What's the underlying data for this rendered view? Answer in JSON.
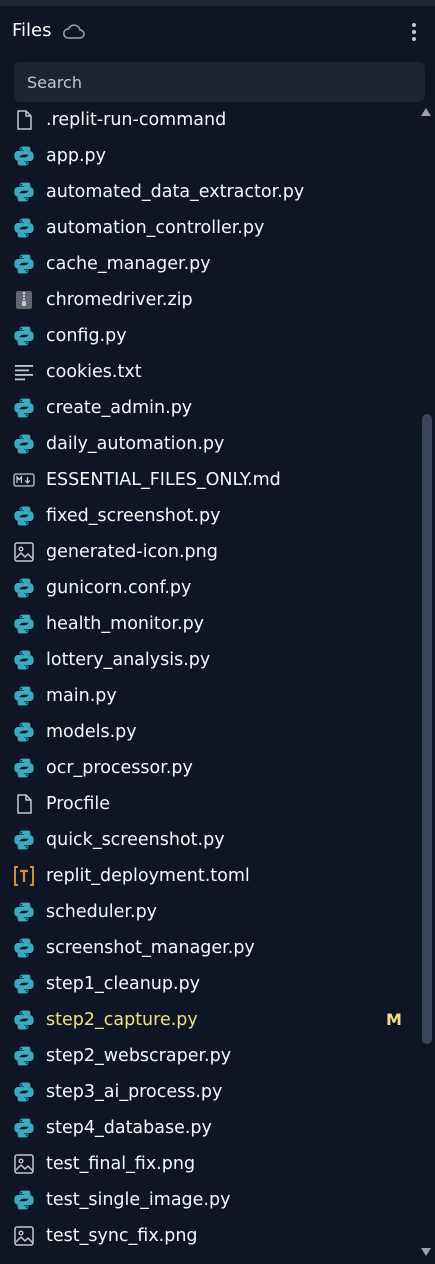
{
  "header": {
    "title": "Files",
    "cloud_icon": "cloud-icon",
    "menu_icon": "kebab-menu-icon"
  },
  "search": {
    "placeholder": "Search"
  },
  "colors": {
    "background": "#0e1525",
    "python": "#3ba9c2",
    "modified": "#f0e083",
    "toml": "#d98a3f",
    "generic_icon": "#c2c8cc"
  },
  "files": [
    {
      "name": ".replit-run-command",
      "icon": "file-icon"
    },
    {
      "name": "app.py",
      "icon": "python-icon"
    },
    {
      "name": "automated_data_extractor.py",
      "icon": "python-icon"
    },
    {
      "name": "automation_controller.py",
      "icon": "python-icon"
    },
    {
      "name": "cache_manager.py",
      "icon": "python-icon"
    },
    {
      "name": "chromedriver.zip",
      "icon": "zip-icon"
    },
    {
      "name": "config.py",
      "icon": "python-icon"
    },
    {
      "name": "cookies.txt",
      "icon": "text-file-icon"
    },
    {
      "name": "create_admin.py",
      "icon": "python-icon"
    },
    {
      "name": "daily_automation.py",
      "icon": "python-icon"
    },
    {
      "name": "ESSENTIAL_FILES_ONLY.md",
      "icon": "markdown-icon"
    },
    {
      "name": "fixed_screenshot.py",
      "icon": "python-icon"
    },
    {
      "name": "generated-icon.png",
      "icon": "image-icon"
    },
    {
      "name": "gunicorn.conf.py",
      "icon": "python-icon"
    },
    {
      "name": "health_monitor.py",
      "icon": "python-icon"
    },
    {
      "name": "lottery_analysis.py",
      "icon": "python-icon"
    },
    {
      "name": "main.py",
      "icon": "python-icon"
    },
    {
      "name": "models.py",
      "icon": "python-icon"
    },
    {
      "name": "ocr_processor.py",
      "icon": "python-icon"
    },
    {
      "name": "Procfile",
      "icon": "file-icon"
    },
    {
      "name": "quick_screenshot.py",
      "icon": "python-icon"
    },
    {
      "name": "replit_deployment.toml",
      "icon": "toml-icon"
    },
    {
      "name": "scheduler.py",
      "icon": "python-icon"
    },
    {
      "name": "screenshot_manager.py",
      "icon": "python-icon"
    },
    {
      "name": "step1_cleanup.py",
      "icon": "python-icon"
    },
    {
      "name": "step2_capture.py",
      "icon": "python-icon",
      "badge": "M"
    },
    {
      "name": "step2_webscraper.py",
      "icon": "python-icon"
    },
    {
      "name": "step3_ai_process.py",
      "icon": "python-icon"
    },
    {
      "name": "step4_database.py",
      "icon": "python-icon"
    },
    {
      "name": "test_final_fix.png",
      "icon": "image-icon"
    },
    {
      "name": "test_single_image.py",
      "icon": "python-icon"
    },
    {
      "name": "test_sync_fix.png",
      "icon": "image-icon"
    }
  ]
}
